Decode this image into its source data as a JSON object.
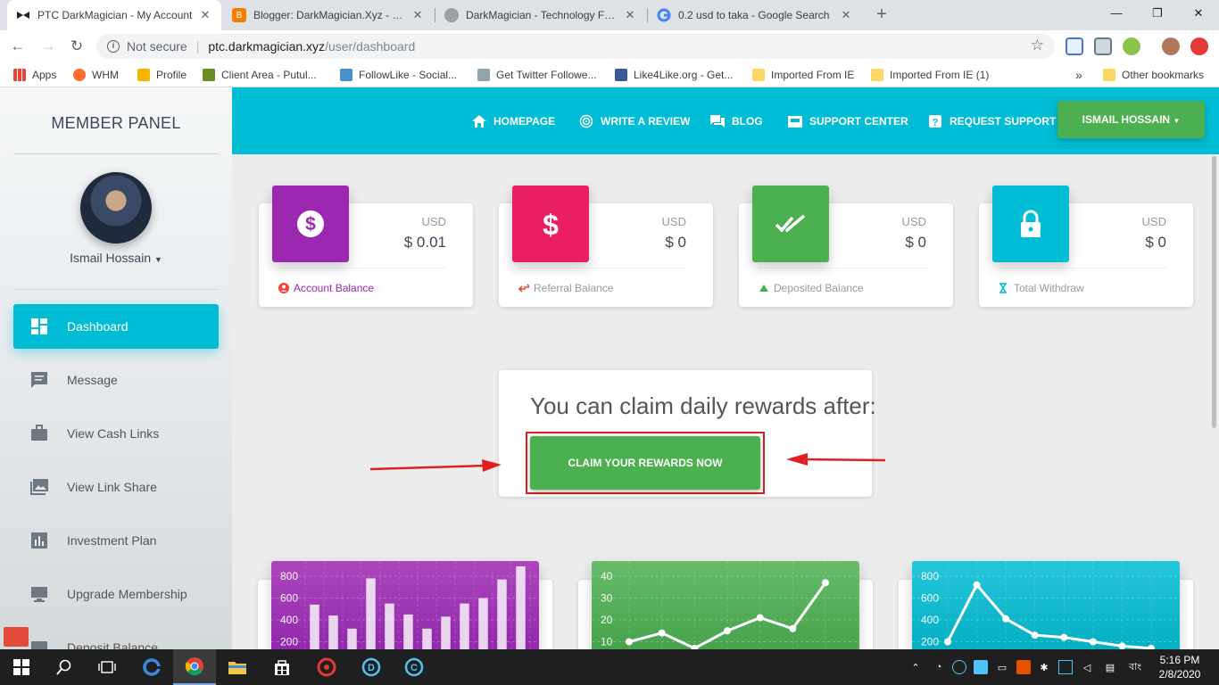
{
  "browser": {
    "tabs": [
      {
        "title": "PTC DarkMagician - My Account",
        "active": true
      },
      {
        "title": "Blogger: DarkMagician.Xyz - Create",
        "active": false
      },
      {
        "title": "DarkMagician - Technology For Life",
        "active": false
      },
      {
        "title": "0.2 usd to taka - Google Search",
        "active": false
      }
    ],
    "new_tab": "+",
    "address": {
      "security": "Not secure",
      "host": "ptc.darkmagician.xyz",
      "path": "/user/dashboard"
    },
    "bookmarks": [
      "Apps",
      "WHM",
      "Profile",
      "Client Area - Putul...",
      "FollowLike - Social...",
      "Get Twitter Followe...",
      "Like4Like.org - Get...",
      "Imported From IE",
      "Imported From IE (1)"
    ],
    "bookmarks_more": "»",
    "other_bookmarks": "Other bookmarks"
  },
  "sidebar": {
    "title": "MEMBER PANEL",
    "user_name": "Ismail Hossain",
    "menu": [
      {
        "label": "Dashboard",
        "active": true
      },
      {
        "label": "Message"
      },
      {
        "label": "View Cash Links"
      },
      {
        "label": "View Link Share"
      },
      {
        "label": "Investment Plan"
      },
      {
        "label": "Upgrade Membership"
      },
      {
        "label": "Deposit Balance"
      }
    ]
  },
  "topnav": {
    "items": [
      "HOMEPAGE",
      "WRITE A REVIEW",
      "BLOG",
      "SUPPORT CENTER",
      "REQUEST SUPPORT"
    ],
    "user_button": "ISMAIL HOSSAIN"
  },
  "cards": [
    {
      "currency": "USD",
      "amount": "$ 0.01",
      "label": "Account Balance",
      "color": "#9c27b0",
      "footer_color": "#9c27b0",
      "icon": "dollar-circle-icon"
    },
    {
      "currency": "USD",
      "amount": "$ 0",
      "label": "Referral Balance",
      "color": "#e91e63",
      "footer_color": "#999999",
      "icon": "dollar-icon"
    },
    {
      "currency": "USD",
      "amount": "$ 0",
      "label": "Deposited Balance",
      "color": "#4caf50",
      "footer_color": "#999999",
      "icon": "double-check-icon"
    },
    {
      "currency": "USD",
      "amount": "$ 0",
      "label": "Total Withdraw",
      "color": "#00bcd4",
      "footer_color": "#999999",
      "icon": "lock-icon"
    }
  ],
  "claim": {
    "text": "You can claim daily rewards after:",
    "button": "CLAIM YOUR REWARDS NOW"
  },
  "charts": [
    {
      "type": "bar",
      "color": "#9c27b0",
      "y_ticks": [
        "800",
        "600",
        "400",
        "200"
      ],
      "ylim": [
        0,
        800
      ],
      "values": [
        540,
        440,
        320,
        780,
        550,
        450,
        320,
        430,
        550,
        600,
        770,
        890
      ]
    },
    {
      "type": "line",
      "color": "#4caf50",
      "y_ticks": [
        "40",
        "30",
        "20",
        "10"
      ],
      "ylim": [
        0,
        40
      ],
      "values": [
        10,
        14,
        7,
        15,
        21,
        16,
        37
      ]
    },
    {
      "type": "line",
      "color": "#00bcd4",
      "y_ticks": [
        "800",
        "600",
        "400",
        "200"
      ],
      "ylim": [
        0,
        800
      ],
      "values": [
        200,
        720,
        410,
        260,
        240,
        200,
        160,
        140
      ]
    }
  ],
  "taskbar": {
    "clock_time": "5:16 PM",
    "clock_date": "2/8/2020",
    "language": "বাং"
  }
}
